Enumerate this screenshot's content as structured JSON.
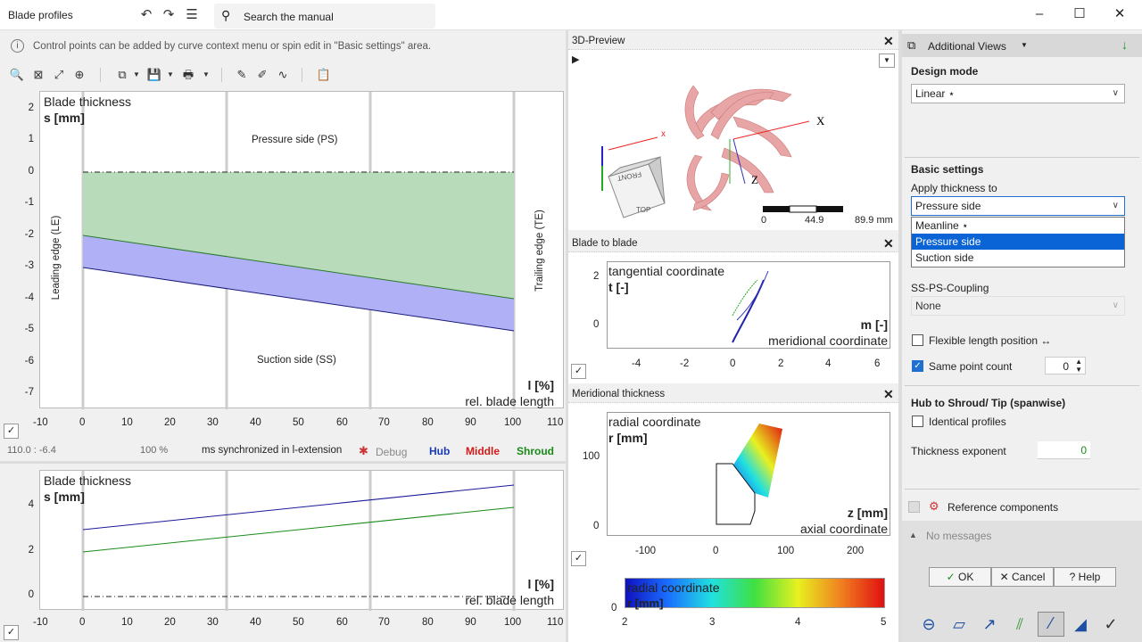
{
  "window": {
    "title": "Blade profiles",
    "search_placeholder": "Search the manual"
  },
  "info": {
    "text": "Control points can be added by curve context menu or spin edit in \"Basic settings\" area."
  },
  "main_plot": {
    "title": "Blade thickness",
    "ylabel": "s [mm]",
    "xlabel": "l [%]",
    "xlabel2": "rel. blade length",
    "pressure_label": "Pressure side (PS)",
    "suction_label": "Suction side (SS)",
    "le_label": "Leading edge (LE)",
    "te_label": "Trailing edge (TE)",
    "yticks": [
      "2",
      "1",
      "0",
      "-1",
      "-2",
      "-3",
      "-4",
      "-5",
      "-6",
      "-7"
    ],
    "xticks": [
      "-10",
      "0",
      "10",
      "20",
      "30",
      "40",
      "50",
      "60",
      "70",
      "80",
      "90",
      "100",
      "110"
    ]
  },
  "status": {
    "coords": "110.0 : -6.4",
    "zoom": "100 %",
    "sync": "ms synchronized in l-extension",
    "debug": "Debug",
    "hub": "Hub",
    "middle": "Middle",
    "shroud": "Shroud"
  },
  "lower_plot": {
    "title": "Blade thickness",
    "ylabel": "s [mm]",
    "xlabel": "l [%]",
    "xlabel2": "rel. blade length",
    "yticks": [
      "4",
      "2",
      "0"
    ],
    "xticks": [
      "-10",
      "0",
      "10",
      "20",
      "30",
      "40",
      "50",
      "60",
      "70",
      "80",
      "90",
      "100",
      "110"
    ]
  },
  "preview3d": {
    "title": "3D-Preview",
    "scale": [
      "0",
      "44.9",
      "89.9 mm"
    ],
    "axis_x": "X",
    "axis_z": "Z",
    "cube_front": "FRONT",
    "cube_top": "TOP"
  },
  "b2b": {
    "title": "Blade to blade",
    "ylabel1": "tangential coordinate",
    "ylabel2": "t [-]",
    "xlabel1": "m [-]",
    "xlabel2": "meridional coordinate",
    "yticks": [
      "2",
      "0"
    ],
    "xticks": [
      "-4",
      "-2",
      "0",
      "2",
      "4",
      "6"
    ]
  },
  "meridional": {
    "title": "Meridional thickness",
    "ylabel1": "radial coordinate",
    "ylabel2": "r [mm]",
    "xlabel1": "z [mm]",
    "xlabel2": "axial coordinate",
    "yticks": [
      "100",
      "0"
    ],
    "xticks": [
      "-100",
      "0",
      "100",
      "200"
    ]
  },
  "colorbar": {
    "label1": "radial coordinate",
    "label2": "r [mm]",
    "zero": "0",
    "ticks": [
      "2",
      "3",
      "4",
      "5"
    ]
  },
  "right": {
    "header": "Additional Views",
    "design_mode_title": "Design mode",
    "design_mode_value": "Linear ⋆",
    "basic_settings_title": "Basic settings",
    "apply_label": "Apply thickness to",
    "apply_value": "Pressure side",
    "dropdown": [
      "Meanline ⋆",
      "Pressure side",
      "Suction side"
    ],
    "coupling_label": "SS-PS-Coupling",
    "coupling_value": "None",
    "flexible_label": "Flexible length position ↔",
    "same_point_label": "Same point count",
    "same_point_value": "0",
    "hub_title": "Hub to Shroud/ Tip (spanwise)",
    "identical_label": "Identical profiles",
    "exponent_label": "Thickness exponent",
    "exponent_value": "0",
    "reference_label": "Reference components",
    "messages": "No messages",
    "ok": "OK",
    "cancel": "Cancel",
    "help": "Help"
  }
}
